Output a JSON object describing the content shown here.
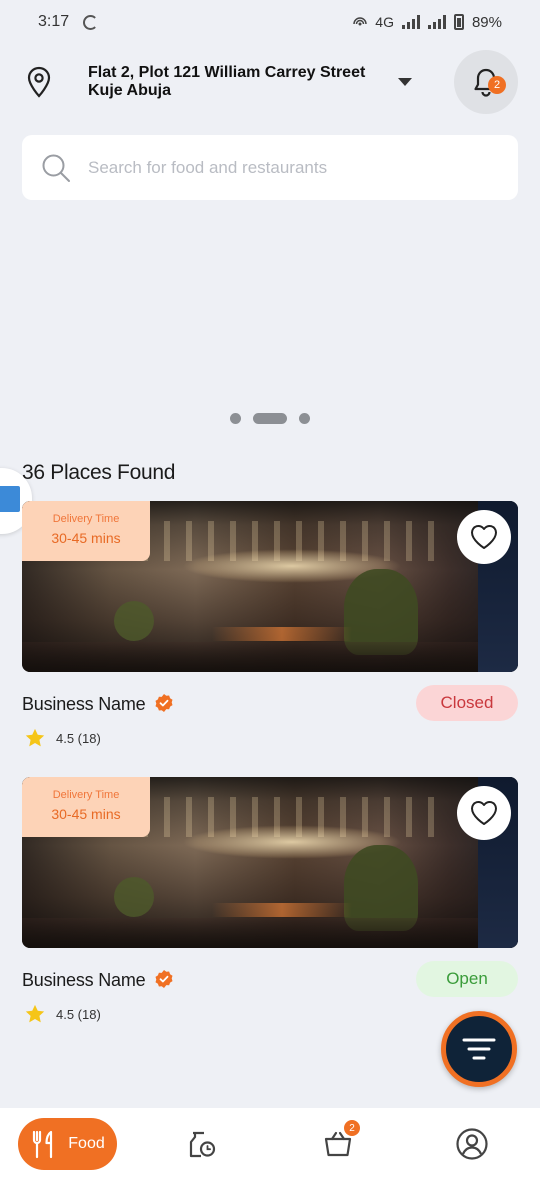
{
  "status_bar": {
    "time": "3:17",
    "network": "4G",
    "battery": "89%"
  },
  "header": {
    "address": "Flat 2, Plot 121 William Carrey Street Kuje Abuja",
    "notification_count": "2"
  },
  "search": {
    "placeholder": "Search for food and restaurants"
  },
  "results": {
    "title": "36 Places Found",
    "items": [
      {
        "delivery_label": "Delivery Time",
        "delivery_time": "30-45 mins",
        "name": "Business Name",
        "status": "Closed",
        "rating": "4.5 (18)"
      },
      {
        "delivery_label": "Delivery Time",
        "delivery_time": "30-45 mins",
        "name": "Business Name",
        "status": "Open",
        "rating": "4.5 (18)"
      }
    ]
  },
  "bottom_nav": {
    "food_label": "Food",
    "cart_count": "2"
  },
  "colors": {
    "accent": "#f07023",
    "dark": "#0f2338",
    "closed": "#c9383d",
    "open": "#3a9c3a"
  }
}
